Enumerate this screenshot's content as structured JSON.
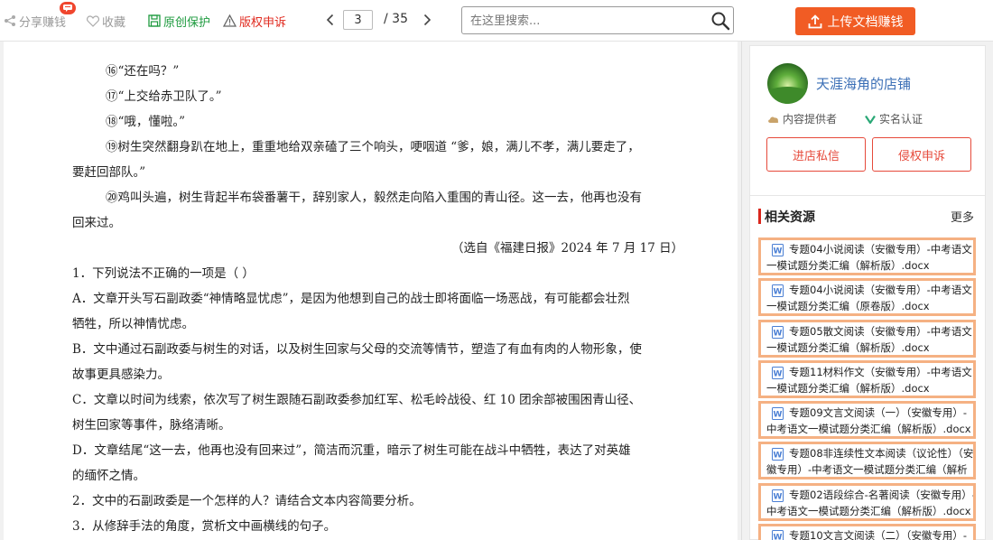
{
  "toolbar": {
    "share": "分享赚钱",
    "badge_icon": "chat-bubble-icon",
    "favorite": "收藏",
    "original": "原创保护",
    "report": "版权申诉",
    "current_page": "3",
    "total_pages": "/ 35",
    "search_placeholder": "在这里搜索...",
    "upload": "上传文档赚钱"
  },
  "document": {
    "lines": [
      "⑯“还在吗？”",
      "⑰“上交给赤卫队了。”",
      "⑱“哦，懂啦。”",
      "⑲树生突然翻身趴在地上，重重地给双亲磕了三个响头，哽咽道 “爹，娘，满儿不孝，满儿要走了，",
      "要赶回部队。”",
      "⑳鸡叫头遍，树生背起半布袋番薯干，辞别家人，毅然走向陷入重围的青山径。这一去，他再也没有",
      "回来过。",
      "（选自《福建日报》2024 年 7 月 17 日）",
      "1．下列说法不正确的一项是（          ）",
      "A．文章开头写石副政委“神情略显忧虑”，是因为他想到自己的战士即将面临一场恶战，有可能都会壮烈",
      "牺牲，所以神情忧虑。",
      "B．文中通过石副政委与树生的对话，以及树生回家与父母的交流等情节，塑造了有血有肉的人物形象，使",
      "故事更具感染力。",
      "C．文章以时间为线索，依次写了树生跟随石副政委参加红军、松毛岭战役、红 10 团余部被围困青山径、",
      "树生回家等事件，脉络清晰。",
      "D．文章结尾“这一去，他再也没有回来过”，简洁而沉重，暗示了树生可能在战斗中牺牲，表达了对英雄",
      "的缅怀之情。",
      "2．文中的石副政委是一个怎样的人？请结合文本内容简要分析。",
      "3．从修辞手法的角度，赏析文中画横线的句子。"
    ]
  },
  "shop": {
    "name": "天涯海角的店铺",
    "provider": "内容提供者",
    "verified": "实名认证",
    "message_btn": "进店私信",
    "infringement_btn": "侵权申诉"
  },
  "related": {
    "title": "相关资源",
    "more": "更多",
    "items": [
      {
        "line1": "专题04小说阅读（安徽专用）-中考语文",
        "line2": "一模试题分类汇编（解析版）.docx"
      },
      {
        "line1": "专题04小说阅读（安徽专用）-中考语文",
        "line2": "一模试题分类汇编（原卷版）.docx"
      },
      {
        "line1": "专题05散文阅读（安徽专用）-中考语文",
        "line2": "一模试题分类汇编（解析版）.docx"
      },
      {
        "line1": "专题11材料作文（安徽专用）-中考语文",
        "line2": "一模试题分类汇编（解析版）.docx"
      },
      {
        "line1": "专题09文言文阅读（一）（安徽专用）-",
        "line2": "中考语文一模试题分类汇编（解析版）.docx"
      },
      {
        "line1": "专题08非连续性文本阅读（议论性）（安",
        "line2": "徽专用）-中考语文一模试题分类汇编（解析"
      },
      {
        "line1": "专题02语段综合-名著阅读（安徽专用）-",
        "line2": "中考语文一模试题分类汇编（解析版）.docx"
      },
      {
        "line1": "专题10文言文阅读（二）（安徽专用）-",
        "line2": ""
      }
    ]
  },
  "colors": {
    "accent": "#f15c24",
    "report_red": "#e02a1f",
    "original_green": "#1d9a3e",
    "shop_link": "#3b6fb6",
    "item_border": "#f5b183"
  }
}
